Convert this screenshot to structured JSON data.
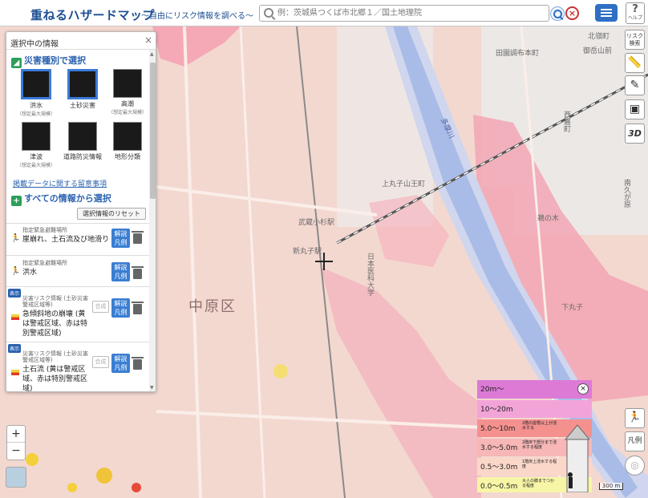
{
  "header": {
    "title": "重ねるハザードマップ",
    "subtitle": "～自由にリスク情報を調べる～",
    "search_placeholder": "例：茨城県つくば市北郷１／国土地理院",
    "help_label": "ヘルプ"
  },
  "panel": {
    "title": "選択中の情報",
    "by_hazard_label": "災害種別で選択",
    "hazards": [
      {
        "label": "洪水",
        "sub": "（想定最大規模）",
        "selected": true
      },
      {
        "label": "土砂災害",
        "sub": "",
        "selected": true
      },
      {
        "label": "高潮",
        "sub": "（想定最大規模）",
        "selected": false
      },
      {
        "label": "津波",
        "sub": "（想定最大規模）",
        "selected": false
      },
      {
        "label": "道路防災情報",
        "sub": "",
        "selected": false
      },
      {
        "label": "地形分類",
        "sub": "",
        "selected": false
      }
    ],
    "notes_link": "掲載データに関する留意事項",
    "all_info_label": "すべての情報から選択",
    "reset_label": "選択情報のリセット",
    "layers": [
      {
        "category": "指定緊急避難場所",
        "name": "崖崩れ、土石流及び地滑り",
        "legend_btn": "解説\n凡例"
      },
      {
        "category": "指定緊急避難場所",
        "name": "洪水",
        "legend_btn": "解説\n凡例"
      },
      {
        "category": "災害リスク情報 (土砂災害警戒区域等)",
        "name": "急傾斜地の崩壊 (黄は警戒区域、赤は特別警戒区域)",
        "legend_btn": "解説\n凡例",
        "show": "表示",
        "combine": "合成"
      },
      {
        "category": "災害リスク情報 (土砂災害警戒区域等)",
        "name": "土石流 (黄は警戒区域、赤は特別警戒区域)",
        "legend_btn": "解説\n凡例",
        "show": "表示",
        "combine": "合成"
      }
    ]
  },
  "toolbar": {
    "risk_label": "リスク検索",
    "threed_label": "3D",
    "hanrei_label": "凡例"
  },
  "legend": {
    "rows": [
      {
        "value": "20m～",
        "desc": "",
        "color": "#dc7ad6"
      },
      {
        "value": "10～20m",
        "desc": "",
        "color": "#f2a4d8"
      },
      {
        "value": "5.0～10m",
        "desc": "2階の屋根以上が浸水する",
        "color": "#f4918f"
      },
      {
        "value": "3.0～5.0m",
        "desc": "2階床下部分まで浸水する程度",
        "color": "#f6b7b6"
      },
      {
        "value": "0.5～3.0m",
        "desc": "1階床上浸水する程度",
        "color": "#fbd7c9"
      },
      {
        "value": "0.0～0.5m",
        "desc": "大人の膝までつかる程度",
        "color": "#f7f5a6"
      }
    ],
    "close_label": "×"
  },
  "map": {
    "ward": "中原区",
    "place_labels": [
      "田園調布本町",
      "北嶺町",
      "御岳山前",
      "西嘉町",
      "南久が原",
      "武蔵小杉駅",
      "新丸子駅",
      "上丸子山王町",
      "日本医科大学",
      "下丸子",
      "鵜の木",
      "多摩川"
    ],
    "scale": "300 m"
  },
  "colors": {
    "brand": "#1d4f91",
    "river": "#b8c9ec",
    "flood": "#f2a6b4"
  }
}
